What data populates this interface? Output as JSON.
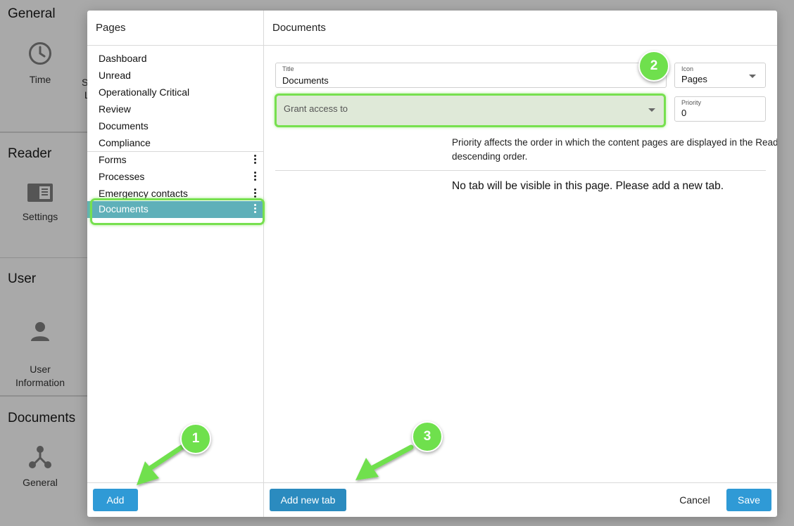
{
  "background": {
    "sections": [
      {
        "title": "General",
        "tiles": [
          {
            "label": "Time",
            "icon": "clock-icon"
          }
        ],
        "cut_label": "S\nL"
      },
      {
        "title": "Reader",
        "tiles": [
          {
            "label": "Settings",
            "icon": "reader-settings-icon"
          }
        ]
      },
      {
        "title": "User",
        "tiles": [
          {
            "label": "User\nInformation",
            "icon": "user-icon"
          }
        ]
      },
      {
        "title": "Documents",
        "tiles": [
          {
            "label": "General",
            "icon": "share-nodes-icon"
          }
        ]
      }
    ]
  },
  "dialog": {
    "left": {
      "title": "Pages",
      "pages": [
        "Dashboard",
        "Unread",
        "Operationally Critical",
        "Review",
        "Documents",
        "Compliance"
      ],
      "tabs": [
        {
          "label": "Forms"
        },
        {
          "label": "Processes"
        },
        {
          "label": "Emergency contacts"
        },
        {
          "label": "Documents",
          "selected": true
        }
      ],
      "add_label": "Add"
    },
    "right": {
      "title": "Documents",
      "title_field": {
        "label": "Title",
        "value": "Documents"
      },
      "icon_field": {
        "label": "Icon",
        "value": "Pages"
      },
      "priority_field": {
        "label": "Priority",
        "value": "0"
      },
      "grant_placeholder": "Grant access to",
      "info": "Priority affects the order in which the content pages are displayed in the Reader. Pages are sorted by priority in a descending order.",
      "empty_message": "No tab will be visible in this page. Please add a new tab.",
      "add_tab_label": "Add new tab",
      "cancel_label": "Cancel",
      "save_label": "Save"
    }
  },
  "annotations": {
    "badges": [
      "1",
      "2",
      "3"
    ],
    "color": "#6fe04d"
  }
}
